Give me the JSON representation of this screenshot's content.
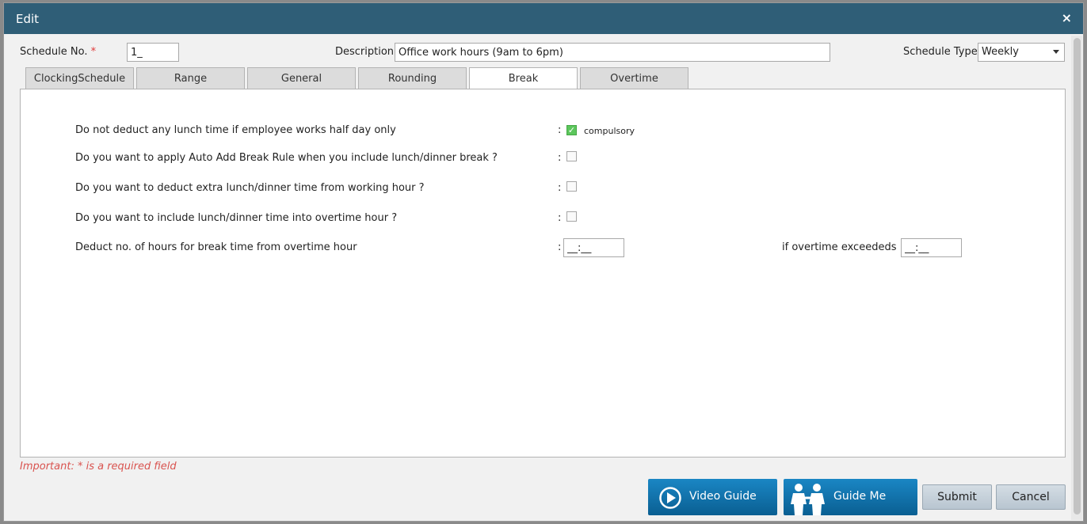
{
  "dialog": {
    "title": "Edit",
    "close_glyph": "×"
  },
  "header": {
    "schedule_no_label": "Schedule No.",
    "required_mark": "*",
    "schedule_no_value": "1_",
    "description_label": "Description",
    "description_value": "Office work hours (9am to 6pm)",
    "schedule_type_label": "Schedule Type",
    "schedule_type_value": "Weekly"
  },
  "tabs": [
    {
      "label": "ClockingSchedule"
    },
    {
      "label": "Range"
    },
    {
      "label": "General"
    },
    {
      "label": "Rounding"
    },
    {
      "label": "Break"
    },
    {
      "label": "Overtime"
    }
  ],
  "active_tab": "Break",
  "break": {
    "colon": ":",
    "rows": [
      {
        "label": "Do not deduct any lunch time if employee works half day only",
        "checked": true,
        "note": "compulsory"
      },
      {
        "label": "Do you want to apply Auto Add Break Rule when you include lunch/dinner break ?",
        "checked": false
      },
      {
        "label": "Do you want to deduct extra lunch/dinner time from working hour ?",
        "checked": false
      },
      {
        "label": "Do you want to include lunch/dinner time into overtime hour ?",
        "checked": false
      }
    ],
    "deduct_label": "Deduct no. of hours for break time from overtime hour",
    "deduct_value": "__:__",
    "exceed_label": "if overtime exceededs",
    "exceed_value": "__:__"
  },
  "footer": {
    "note": "Important: * is a required field",
    "video_guide": "Video Guide",
    "guide_me": "Guide Me",
    "submit": "Submit",
    "cancel": "Cancel"
  },
  "colors": {
    "titlebar": "#2f5e77",
    "accent_blue": "#0a6aa5",
    "check_green": "#5cc65c",
    "required_red": "#e03a3a"
  }
}
